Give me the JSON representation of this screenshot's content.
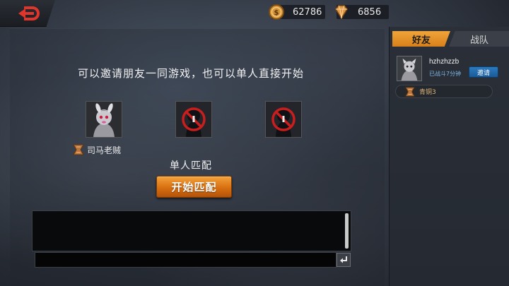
{
  "header": {
    "back_icon": "back-arrow-icon",
    "gold": {
      "icon": "coin-icon",
      "value": "62786"
    },
    "gems": {
      "icon": "diamond-icon",
      "value": "6856"
    }
  },
  "main": {
    "invite_text": "可以邀请朋友一同游戏，也可以单人直接开始",
    "slots": [
      {
        "state": "occupied",
        "player_name": "司马老贼",
        "rank_icon": "bronze-rank-icon"
      },
      {
        "state": "empty",
        "icon": "no-entry-icon"
      },
      {
        "state": "empty",
        "icon": "no-entry-icon"
      }
    ],
    "mode_label": "单人匹配",
    "start_button": "开始匹配"
  },
  "chat": {
    "input_placeholder": "",
    "send_icon": "enter-icon"
  },
  "side": {
    "tabs": [
      {
        "label": "好友",
        "active": true
      },
      {
        "label": "战队",
        "active": false
      }
    ],
    "friend": {
      "name": "hzhzhzzb",
      "status": "已战斗7分钟",
      "invite_label": "邀请"
    },
    "rank": {
      "icon": "bronze-rank-icon",
      "label": "青铜3"
    }
  },
  "colors": {
    "accent_orange": "#e08a22",
    "invite_blue": "#2368ad",
    "rank_text": "#e0b675"
  }
}
